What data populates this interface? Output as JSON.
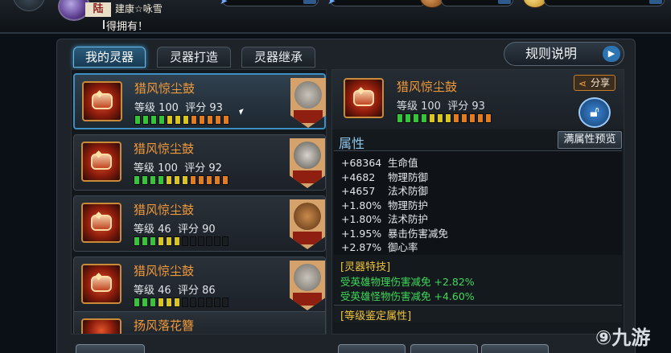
{
  "top": {
    "player_name": "建康☆咏雪",
    "name_tag": "陆",
    "ticker": "得拥有！"
  },
  "tabs": [
    {
      "label": "我的灵器",
      "active": true
    },
    {
      "label": "灵器打造",
      "active": false
    },
    {
      "label": "灵器继承",
      "active": false
    }
  ],
  "rules_button": "规则说明",
  "list": [
    {
      "name": "猎风惊尘鼓",
      "level_text": "等级 100",
      "score_text": "评分 93",
      "bars": [
        "g",
        "g",
        "g",
        "g",
        "y",
        "y",
        "y",
        "o",
        "o",
        "o",
        "o",
        "o"
      ],
      "selected": true
    },
    {
      "name": "猎风惊尘鼓",
      "level_text": "等级 100",
      "score_text": "评分 92",
      "bars": [
        "g",
        "g",
        "g",
        "g",
        "y",
        "y",
        "y",
        "o",
        "o",
        "o",
        "o",
        "o"
      ],
      "selected": false
    },
    {
      "name": "猎风惊尘鼓",
      "level_text": "等级 46",
      "score_text": "评分 90",
      "bars": [
        "g",
        "g",
        "g",
        "y",
        "y",
        "y",
        "",
        "",
        "",
        "",
        "",
        ""
      ],
      "selected": false
    },
    {
      "name": "猎风惊尘鼓",
      "level_text": "等级 46",
      "score_text": "评分 86",
      "bars": [
        "g",
        "g",
        "g",
        "y",
        "y",
        "y",
        "",
        "",
        "",
        "",
        "",
        ""
      ],
      "selected": false
    }
  ],
  "partial_item": "扬风落花簪",
  "detail": {
    "name": "猎风惊尘鼓",
    "level_text": "等级 100",
    "score_text": "评分 93",
    "bars": [
      "g",
      "g",
      "g",
      "g",
      "y",
      "y",
      "y",
      "o",
      "o",
      "o",
      "o",
      "o"
    ],
    "share_label": "分享",
    "section_title": "属性",
    "full_attr_button": "满属性预览",
    "attributes": [
      {
        "value": "+68364",
        "name": "生命值"
      },
      {
        "value": "+4682",
        "name": "物理防御"
      },
      {
        "value": "+4657",
        "name": "法术防御"
      },
      {
        "value": "+1.80%",
        "name": "物理防护"
      },
      {
        "value": "+1.80%",
        "name": "法术防护"
      },
      {
        "value": "+1.95%",
        "name": "暴击伤害减免"
      },
      {
        "value": "+2.87%",
        "name": "御心率"
      }
    ],
    "skill_title": "[灵器特技]",
    "skills": [
      "受英雄物理伤害减免 +2.82%",
      "受英雄怪物伤害减免 +4.60%"
    ],
    "appraise_title": "[等级鉴定属性]"
  },
  "watermark": "九游",
  "colors": {
    "accent": "#3c8fc0",
    "item_name": "#f39a3a",
    "skill_text": "#3fd95a",
    "section_gold": "#f0c43a"
  }
}
